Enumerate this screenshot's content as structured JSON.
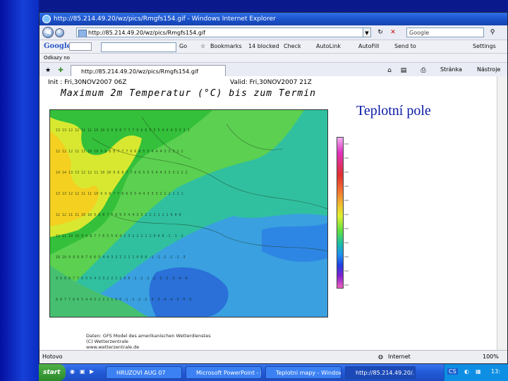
{
  "browser": {
    "title": "http://85.214.49.20/wz/pics/Rmgfs154.gif - Windows Internet Explorer",
    "address": "http://85.214.49.20/wz/pics/Rmgfs154.gif",
    "search_placeholder": "Google",
    "google_bar": {
      "logo": "Google",
      "go": "Go",
      "bookmarks": "Bookmarks",
      "blocked": "14 blocked",
      "check": "Check",
      "autolink": "AutoLink",
      "autofill": "AutoFill",
      "send_to": "Send to",
      "settings": "Settings"
    },
    "favorites_row": "Odkazy  no",
    "tab_label": "http://85.214.49.20/wz/pics/Rmgfs154.gif",
    "tools": {
      "page": "Stránka",
      "tools": "Nástroje"
    },
    "status": {
      "left": "Hotovo",
      "zone": "Internet",
      "zoom": "100%"
    }
  },
  "map": {
    "header_left": "Init : Fri,30NOV2007 06Z",
    "header_right": "Valid: Fri,30NOV2007 21Z",
    "title": "Maximum 2m Temperatur (°C) bis zum Termin",
    "credits": "Daten: GFS Model des amerikanischen Wetterdienstes\n(C) Wetterzentrale\nwww.wetterzentrale.de"
  },
  "slide": {
    "caption": "Teplotní pole"
  },
  "taskbar": {
    "start": "start",
    "items": [
      "HRUZOVI AUG 07",
      "Microsoft PowerPoint - [...",
      "Teplotní mapy - Windows...",
      "http://85.214.49.20/..."
    ],
    "tray_lang": "CS",
    "clock": "13:"
  },
  "colors": {
    "slide_blue": "#0623a8",
    "caption": "#0a1aa8",
    "taskbar": "#245ddb"
  }
}
